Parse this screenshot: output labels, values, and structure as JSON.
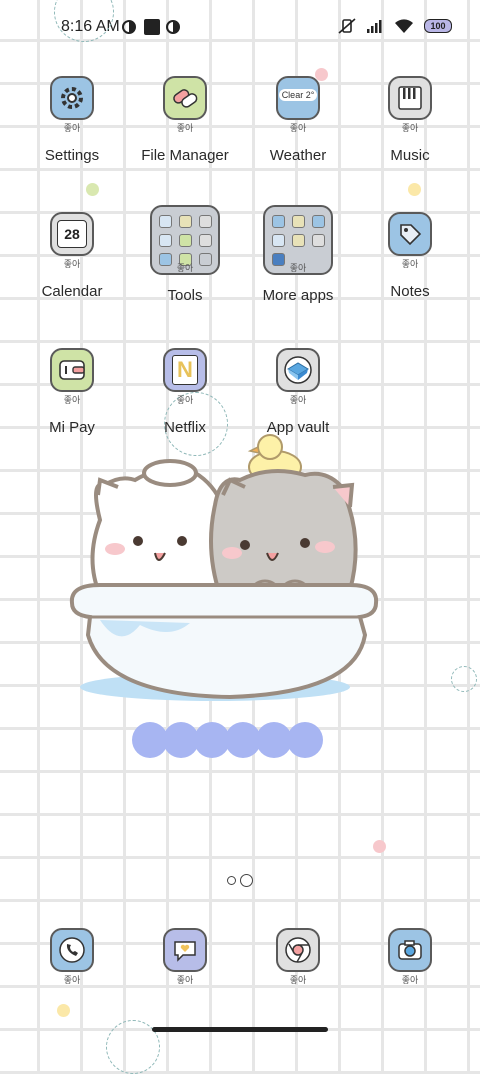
{
  "status": {
    "time": "8:16 AM",
    "battery": "100"
  },
  "icon_badge": "좋아",
  "apps": [
    {
      "label": "Settings",
      "icon": "gear-icon",
      "color": "#9cc4e4"
    },
    {
      "label": "File Manager",
      "icon": "pills-icon",
      "color": "#cfe3a6"
    },
    {
      "label": "Weather",
      "icon": "cloud-icon",
      "color": "#9cc4e4",
      "icon_text": "Clear 2°"
    },
    {
      "label": "Music",
      "icon": "piano-icon",
      "color": "#e0e0e0"
    },
    {
      "label": "Calendar",
      "icon": "calendar-icon",
      "color": "#e0e0e0",
      "icon_text": "28"
    },
    {
      "label": "Tools",
      "icon": "folder-icon",
      "color": "#c9cdd3"
    },
    {
      "label": "More apps",
      "icon": "folder-icon",
      "color": "#c9cdd3"
    },
    {
      "label": "Notes",
      "icon": "tag-icon",
      "color": "#9cc4e4"
    },
    {
      "label": "Mi Pay",
      "icon": "wallet-icon",
      "color": "#cfe3a6"
    },
    {
      "label": "Netflix",
      "icon": "netflix-icon",
      "color": "#b7bde8",
      "icon_text": "N"
    },
    {
      "label": "App vault",
      "icon": "cube-icon",
      "color": "#e0e0e0"
    }
  ],
  "dock": [
    {
      "icon": "phone-icon",
      "color": "#9cc4e4"
    },
    {
      "icon": "message-icon",
      "color": "#b7bde8"
    },
    {
      "icon": "browser-icon",
      "color": "#e0e0e0"
    },
    {
      "icon": "camera-icon",
      "color": "#9cc4e4"
    }
  ]
}
